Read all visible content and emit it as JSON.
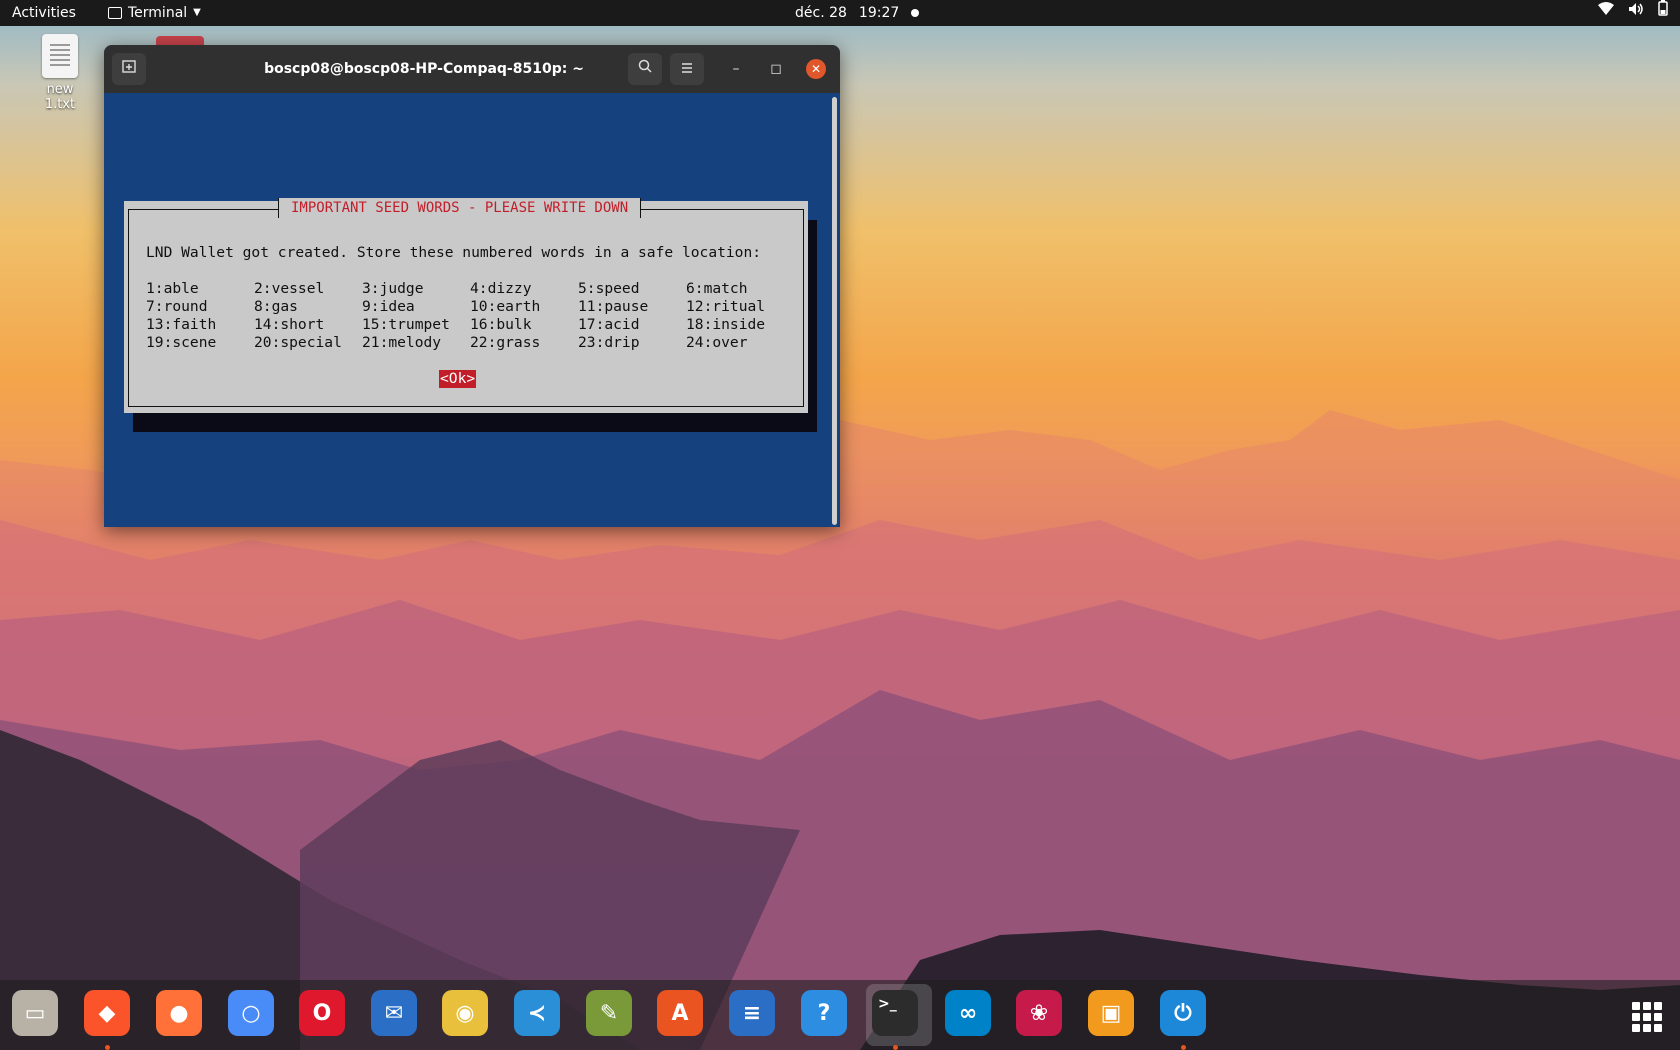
{
  "topbar": {
    "activities": "Activities",
    "app_name": "Terminal",
    "date": "déc. 28",
    "time": "19:27",
    "status_icons": [
      "wifi-icon",
      "volume-icon",
      "battery-icon"
    ]
  },
  "desktop": {
    "file_label": "new 1.txt"
  },
  "terminal": {
    "title": "boscp08@boscp08-HP-Compaq-8510p: ~",
    "dialog": {
      "title": "IMPORTANT SEED WORDS - PLEASE WRITE DOWN",
      "message": "LND Wallet got created. Store these numbered words in a safe location:",
      "words": [
        "1:able",
        "2:vessel",
        "3:judge",
        "4:dizzy",
        "5:speed",
        "6:match",
        "7:round",
        "8:gas",
        "9:idea",
        "10:earth",
        "11:pause",
        "12:ritual",
        "13:faith",
        "14:short",
        "15:trumpet",
        "16:bulk",
        "17:acid",
        "18:inside",
        "19:scene",
        "20:special",
        "21:melody",
        "22:grass",
        "23:drip",
        "24:over"
      ],
      "ok_label": "<Ok>"
    }
  },
  "dock": {
    "apps": [
      {
        "name": "files",
        "color": "#b8b2a6",
        "glyph": "▭",
        "running": false
      },
      {
        "name": "brave",
        "color": "#fb542b",
        "glyph": "◆",
        "running": true
      },
      {
        "name": "firefox",
        "color": "#ff7139",
        "glyph": "●",
        "running": false
      },
      {
        "name": "chromium",
        "color": "#4a8cf7",
        "glyph": "○",
        "running": false
      },
      {
        "name": "opera",
        "color": "#e0182d",
        "glyph": "O",
        "running": false
      },
      {
        "name": "thunderbird",
        "color": "#2a6ec6",
        "glyph": "✉",
        "running": false
      },
      {
        "name": "rhythmbox",
        "color": "#e8c03c",
        "glyph": "◉",
        "running": false
      },
      {
        "name": "vscode",
        "color": "#2b8fd8",
        "glyph": "≺",
        "running": false
      },
      {
        "name": "gimp",
        "color": "#7a9a3a",
        "glyph": "✎",
        "running": false
      },
      {
        "name": "software",
        "color": "#e95420",
        "glyph": "A",
        "running": false
      },
      {
        "name": "writer",
        "color": "#2a6ec6",
        "glyph": "≡",
        "running": false
      },
      {
        "name": "help",
        "color": "#2d8de0",
        "glyph": "?",
        "running": false
      },
      {
        "name": "terminal",
        "color": "#2c2c2c",
        "glyph": ">_",
        "running": true
      },
      {
        "name": "nextcloud",
        "color": "#0082c9",
        "glyph": "∞",
        "running": false
      },
      {
        "name": "raspberry",
        "color": "#c51a4a",
        "glyph": "❀",
        "running": false
      },
      {
        "name": "vmware",
        "color": "#f29a1e",
        "glyph": "▣",
        "running": false
      },
      {
        "name": "timeshift",
        "color": "#1e88d8",
        "glyph": "⏻",
        "running": true
      }
    ]
  }
}
